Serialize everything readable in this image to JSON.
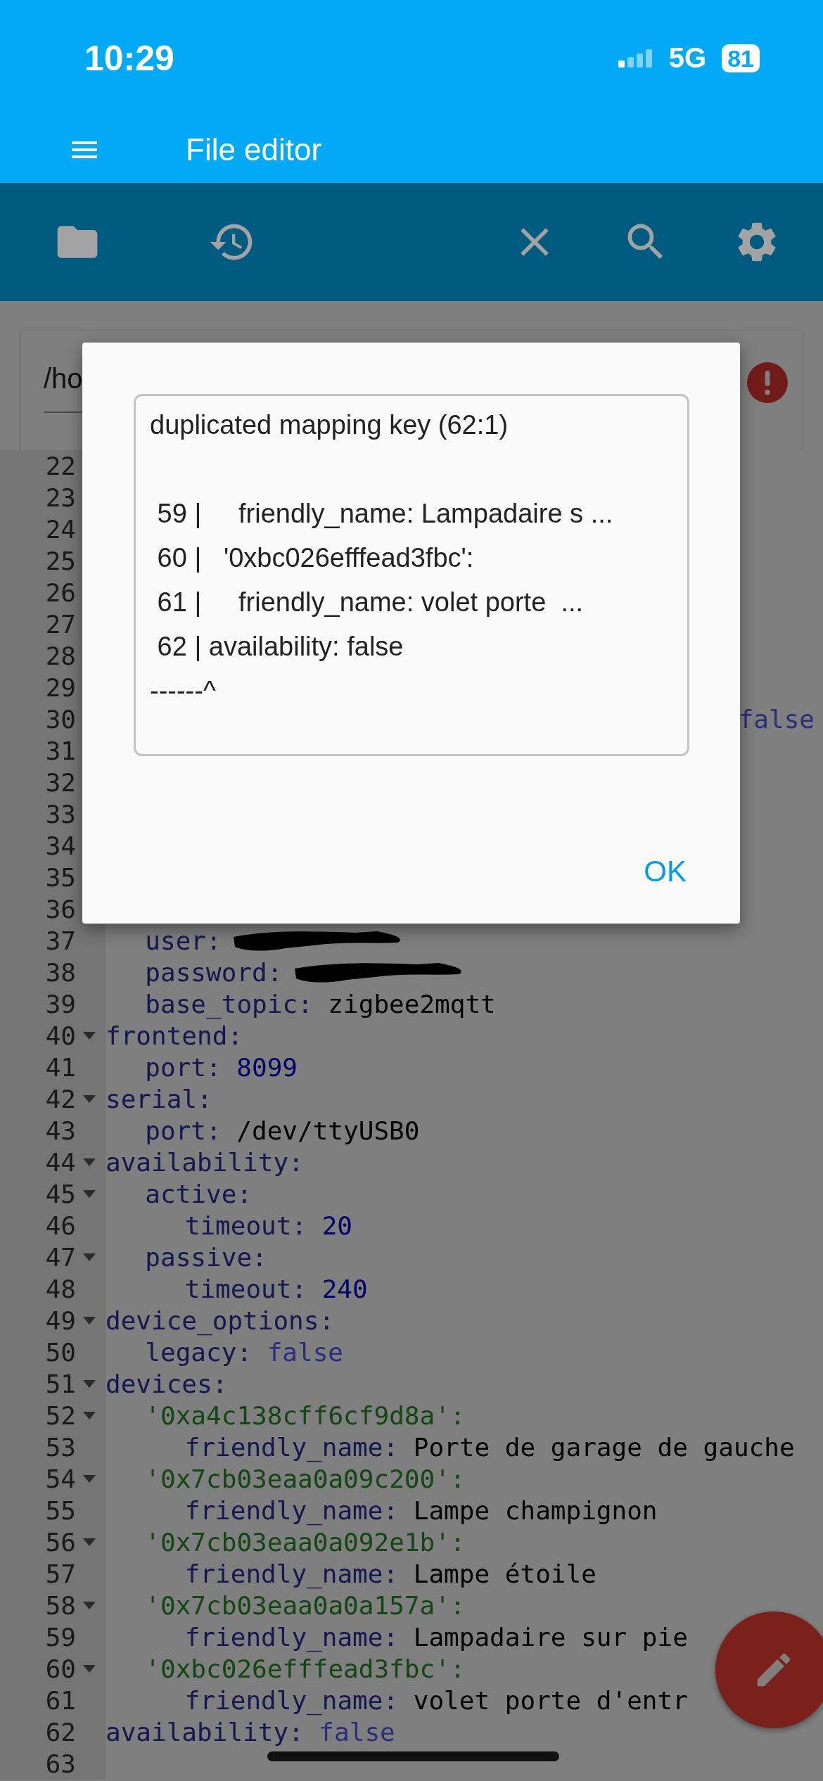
{
  "status_bar": {
    "time": "10:29",
    "network": "5G",
    "battery": "81"
  },
  "app_bar": {
    "title": "File editor"
  },
  "toolbar": {
    "left": [
      {
        "kind": "folder"
      },
      {
        "kind": "history"
      }
    ],
    "right": [
      {
        "kind": "close"
      },
      {
        "kind": "search"
      },
      {
        "kind": "settings"
      }
    ]
  },
  "path_field": {
    "value": "/ho",
    "error": true
  },
  "editor": {
    "lines": [
      {
        "number": "22"
      },
      {
        "number": "23"
      },
      {
        "number": "24"
      },
      {
        "number": "25"
      },
      {
        "number": "26"
      },
      {
        "number": "27"
      },
      {
        "number": "28"
      },
      {
        "number": "29"
      },
      {
        "number": "30",
        "value": "false",
        "kind": "bool",
        "covered": true
      },
      {
        "number": "31"
      },
      {
        "number": "32"
      },
      {
        "number": "33"
      },
      {
        "number": "34"
      },
      {
        "number": "35"
      },
      {
        "number": "36"
      },
      {
        "children": [
          {
            "number": "37",
            "key": "user:",
            "kind": "redacted"
          },
          {
            "number": "38",
            "key": "password:",
            "kind": "redacted"
          },
          {
            "number": "39",
            "key": "base_topic:",
            "value": "zigbee2mqtt",
            "kind": "text"
          }
        ]
      },
      {
        "number": "40",
        "key": "frontend:",
        "kind": "mapping",
        "children": [
          {
            "number": "41",
            "key": "port:",
            "value": "8099",
            "kind": "number"
          }
        ]
      },
      {
        "number": "42",
        "key": "serial:",
        "kind": "mapping",
        "children": [
          {
            "number": "43",
            "key": "port:",
            "value": "/dev/ttyUSB0",
            "kind": "text"
          }
        ]
      },
      {
        "number": "44",
        "key": "availability:",
        "kind": "mapping",
        "children": [
          {
            "number": "45",
            "key": "active:",
            "kind": "mapping",
            "children": [
              {
                "number": "46",
                "key": "timeout:",
                "value": "20",
                "kind": "number"
              }
            ]
          },
          {
            "number": "47",
            "key": "passive:",
            "kind": "mapping",
            "children": [
              {
                "number": "48",
                "key": "timeout:",
                "value": "240",
                "kind": "number"
              }
            ]
          }
        ]
      },
      {
        "number": "49",
        "key": "device_options:",
        "kind": "mapping",
        "children": [
          {
            "number": "50",
            "key": "legacy:",
            "value": "false",
            "kind": "bool"
          }
        ]
      },
      {
        "number": "51",
        "key": "devices:",
        "kind": "mapping",
        "children": [
          {
            "number": "52",
            "key": "'0xa4c138cff6cf9d8a':",
            "kind": "device",
            "children": [
              {
                "number": "53",
                "key": "friendly_name:",
                "value": "Porte de garage de gauche",
                "kind": "text"
              }
            ]
          },
          {
            "number": "54",
            "key": "'0x7cb03eaa0a09c200':",
            "kind": "device",
            "children": [
              {
                "number": "55",
                "key": "friendly_name:",
                "value": "Lampe champignon",
                "kind": "text"
              }
            ]
          },
          {
            "number": "56",
            "key": "'0x7cb03eaa0a092e1b':",
            "kind": "device",
            "children": [
              {
                "number": "57",
                "key": "friendly_name:",
                "value": "Lampe étoile",
                "kind": "text"
              }
            ]
          },
          {
            "number": "58",
            "key": "'0x7cb03eaa0a0a157a':",
            "kind": "device",
            "children": [
              {
                "number": "59",
                "key": "friendly_name:",
                "value": "Lampadaire sur pie",
                "kind": "text"
              }
            ]
          },
          {
            "number": "60",
            "key": "'0xbc026efffead3fbc':",
            "kind": "device",
            "children": [
              {
                "number": "61",
                "key": "friendly_name:",
                "value": "volet porte d'entr",
                "kind": "text"
              }
            ]
          }
        ]
      },
      {
        "number": "62",
        "key": "availability:",
        "value": "false",
        "kind": "bool"
      },
      {
        "number": "63"
      }
    ]
  },
  "dialog": {
    "title": "duplicated mapping key (62:1)",
    "snippet": [
      " 59 |     friendly_name: Lampadaire s ...",
      " 60 |   '0xbc026efffead3fbc':",
      " 61 |     friendly_name: volet porte  ...",
      " 62 | availability: false"
    ],
    "marker": "------^",
    "button": "OK"
  }
}
